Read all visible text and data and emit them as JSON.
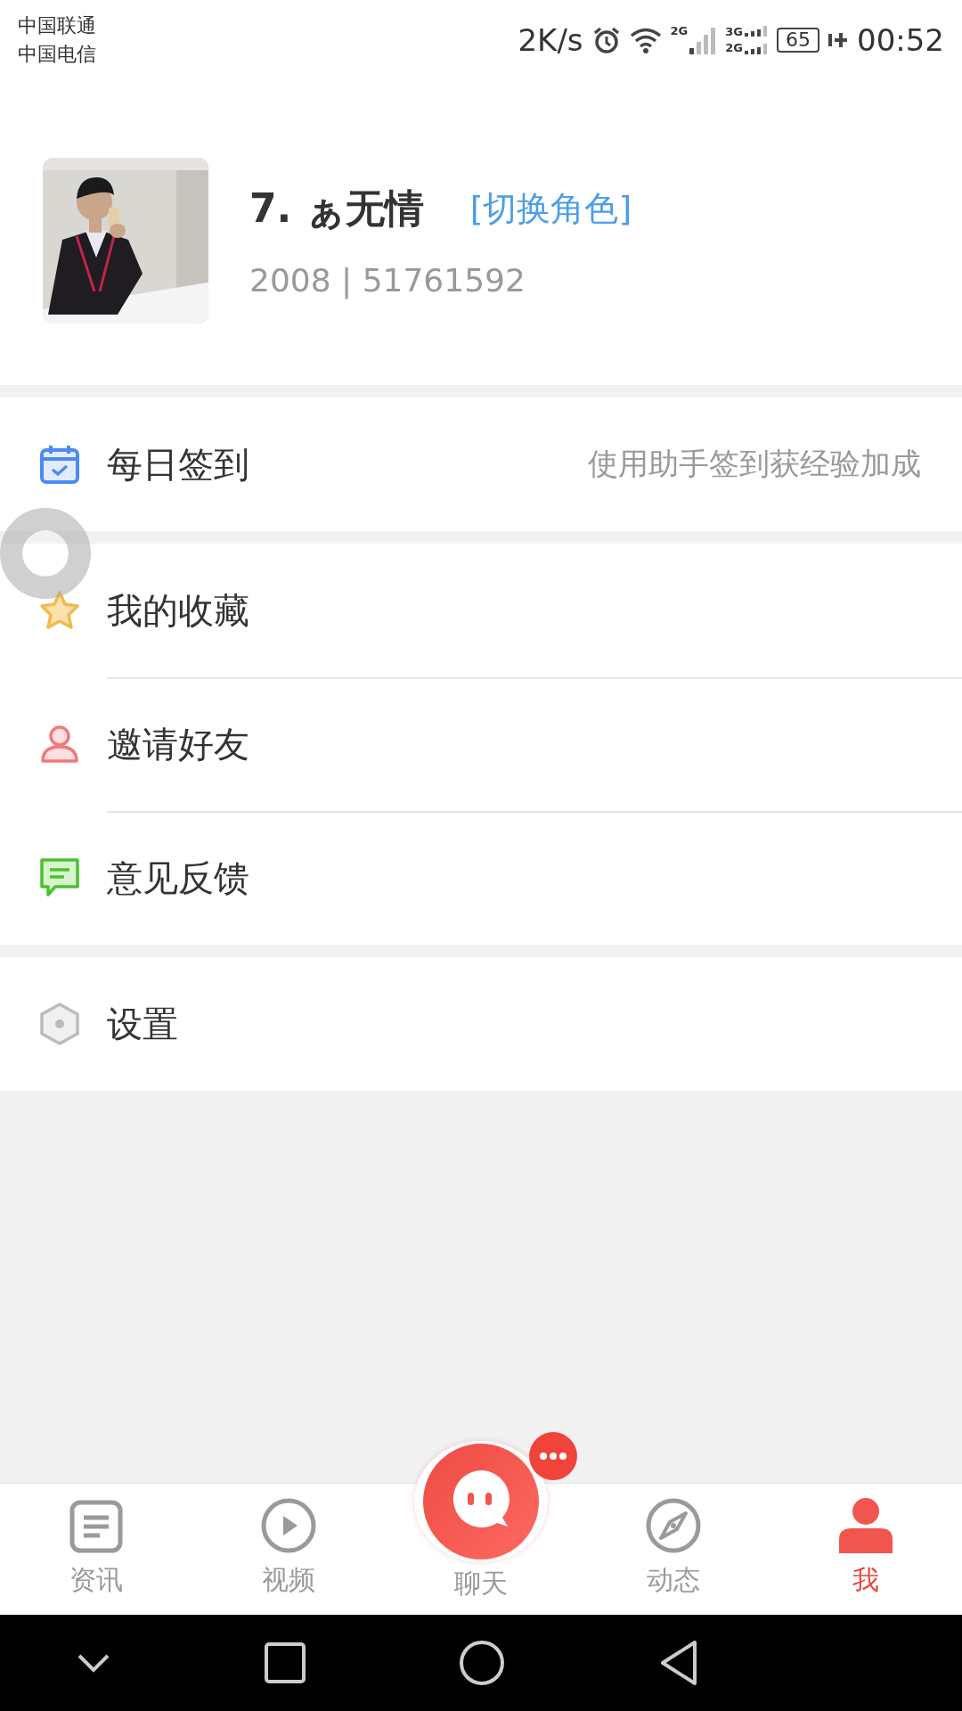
{
  "status_bar": {
    "carriers": [
      "中国联通",
      "中国电信"
    ],
    "speed": "2K/s",
    "signal_labels": [
      {
        "top": "2G"
      },
      {
        "top": "3G",
        "bottom": "2G"
      }
    ],
    "battery": "65",
    "time": "00:52"
  },
  "profile": {
    "name": "7. ぁ无情",
    "switch_role": "[切换角色]",
    "ids": "2008 | 51761592"
  },
  "menu_groups": [
    [
      {
        "label": "每日签到",
        "hint": "使用助手签到获经验加成"
      }
    ],
    [
      {
        "label": "我的收藏"
      },
      {
        "label": "邀请好友"
      },
      {
        "label": "意见反馈"
      }
    ],
    [
      {
        "label": "设置"
      }
    ]
  ],
  "tabs": [
    {
      "label": "资讯",
      "selected": false
    },
    {
      "label": "视频",
      "selected": false
    },
    {
      "label": "聊天",
      "selected": false
    },
    {
      "label": "动态",
      "selected": false
    },
    {
      "label": "我",
      "selected": true
    }
  ]
}
